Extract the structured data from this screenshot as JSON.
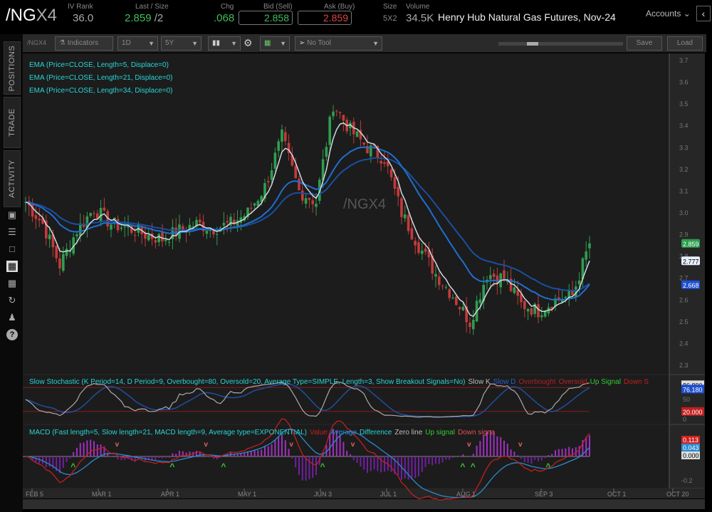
{
  "header": {
    "symbol_prefix": "/NG",
    "symbol_suffix": "X4",
    "iv_rank_label": "IV Rank",
    "iv_rank": "36.0",
    "last_size_label": "Last / Size",
    "last": "2.859",
    "size_sep": "/2",
    "chg_label": "Chg",
    "chg": ".068",
    "bid_label": "Bid (Sell)",
    "bid": "2.858",
    "ask_label": "Ask (Buy)",
    "ask": "2.859",
    "size_label": "Size",
    "size": "5X2",
    "volume_label": "Volume",
    "volume": "34.5K",
    "description": "Henry Hub Natural Gas Futures, Nov-24",
    "accounts": "Accounts"
  },
  "toolbar": {
    "symbol": "/NGX4",
    "indicators": "Indicators",
    "aggregation": "1D",
    "range": "5Y",
    "drawing_tool": "No Tool",
    "save": "Save",
    "load": "Load"
  },
  "sidebar": {
    "tabs": [
      "POSITIONS",
      "TRADE",
      "ACTIVITY"
    ]
  },
  "studies": {
    "ema": [
      "EMA (Price=CLOSE, Length=5, Displace=0)",
      "EMA (Price=CLOSE, Length=21, Displace=0)",
      "EMA (Price=CLOSE, Length=34, Displace=0)"
    ],
    "stoch": "Slow Stochastic (K Period=14, D Period=9, Overbought=80, Oversold=20, Average Type=SIMPLE, Length=3, Show Breakout Signals=No)",
    "stoch_legend": [
      "Slow K",
      "Slow D",
      "Overbought",
      "Oversold",
      "Up Signal",
      "Down S"
    ],
    "macd": "MACD (Fast length=5, Slow length=21, MACD length=9, Average type=EXPONENTIAL)",
    "macd_legend": [
      "Value",
      "Average",
      "Difference",
      "Zero line",
      "Up signal",
      "Down signa"
    ]
  },
  "watermark": "/NGX4",
  "colors": {
    "up": "#2e9e4f",
    "down": "#c23b3b",
    "ema5": "#d0d8e0",
    "ema21": "#1f6fd1",
    "ema34": "#1a4fa0"
  },
  "chart_data": {
    "type": "candlestick",
    "price_axis": {
      "min": 2.3,
      "max": 3.7,
      "ticks": [
        "3.7",
        "3.6",
        "3.5",
        "3.4",
        "3.3",
        "3.2",
        "3.1",
        "3.0",
        "2.9",
        "2.8",
        "2.7",
        "2.6",
        "2.5",
        "2.4",
        "2.3"
      ]
    },
    "x_ticks": [
      "FEB 5",
      "MAR 1",
      "APR 1",
      "MAY 1",
      "JUN 3",
      "JUL 1",
      "AUG 1",
      "SEP 3",
      "OCT 1",
      "OCT 20"
    ],
    "weekly_closes": [
      3.05,
      2.95,
      2.76,
      2.92,
      3.02,
      2.95,
      2.93,
      2.9,
      2.88,
      2.92,
      2.95,
      2.93,
      2.95,
      3.0,
      3.12,
      3.35,
      3.1,
      3.05,
      3.5,
      3.38,
      3.3,
      3.25,
      3.0,
      2.85,
      2.72,
      2.62,
      2.5,
      2.72,
      2.7,
      2.58,
      2.55,
      2.6,
      2.62,
      2.86
    ],
    "last_labels": {
      "last": "2.859",
      "ema5": "2.777",
      "ema21": "2.668"
    },
    "stoch_axis": {
      "labels": [
        "86.890",
        "76.180",
        "50",
        "20.000",
        "0"
      ]
    },
    "macd_axis": {
      "labels": [
        "0.113",
        "0.043",
        "0.000",
        "-0.2"
      ]
    }
  }
}
